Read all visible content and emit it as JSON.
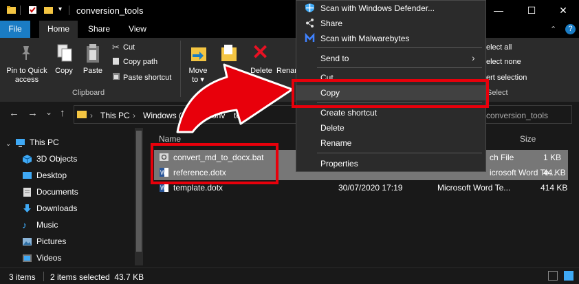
{
  "window": {
    "title": "conversion_tools",
    "controls": {
      "minimize": "—",
      "maximize": "☐",
      "close": "✕"
    }
  },
  "ribbon_tabs": {
    "file": "File",
    "home": "Home",
    "share": "Share",
    "view": "View"
  },
  "ribbon": {
    "pin_to_quick_access_1": "Pin to Quick",
    "pin_to_quick_access_2": "access",
    "copy": "Copy",
    "paste": "Paste",
    "cut": "Cut",
    "copy_path": "Copy path",
    "paste_shortcut": "Paste shortcut",
    "clipboard_group": "Clipboard",
    "move_to_1": "Move",
    "move_to_2": "to ▾",
    "delete": "Delete",
    "rename": "Renam",
    "select_all": "elect all",
    "select_none": "elect none",
    "invert_selection": "ert selection",
    "select_group": "Select"
  },
  "address": {
    "crumb_this_pc": "This PC",
    "crumb_windows": "Windows (C",
    "crumb_folder": "conv",
    "crumb_tools": "tools",
    "search_text": "conversion_tools",
    "nav_back": "←",
    "nav_forward": "→",
    "nav_dropdown": "⌄",
    "nav_up": "↑",
    "sep": "›"
  },
  "nav_pane": {
    "items": [
      {
        "label": "This PC",
        "icon": "computer-icon"
      },
      {
        "label": "3D Objects",
        "icon": "cube-icon"
      },
      {
        "label": "Desktop",
        "icon": "desktop-icon"
      },
      {
        "label": "Documents",
        "icon": "documents-icon"
      },
      {
        "label": "Downloads",
        "icon": "download-icon"
      },
      {
        "label": "Music",
        "icon": "music-icon"
      },
      {
        "label": "Pictures",
        "icon": "pictures-icon"
      },
      {
        "label": "Videos",
        "icon": "videos-icon"
      }
    ]
  },
  "file_list": {
    "columns": {
      "name": "Name",
      "size": "Size"
    },
    "rows": [
      {
        "name": "convert_md_to_docx.bat",
        "date": "",
        "type": "ch File",
        "size": "1 KB",
        "selected": true
      },
      {
        "name": "reference.dotx",
        "date": "",
        "type": "icrosoft Word Te...",
        "size": "44 KB",
        "selected": true
      },
      {
        "name": "template.dotx",
        "date": "30/07/2020 17:19",
        "type": "Microsoft Word Te...",
        "size": "414 KB",
        "selected": false
      }
    ]
  },
  "status": {
    "items_count": "3 items",
    "selection": "2 items selected  43.7 KB"
  },
  "context_menu": {
    "scan_defender": "Scan with Windows Defender...",
    "share": "Share",
    "scan_malwarebytes": "Scan with Malwarebytes",
    "send_to": "Send to",
    "send_to_arrow": "›",
    "cut": "Cut",
    "copy": "Copy",
    "create_shortcut": "Create shortcut",
    "delete": "Delete",
    "rename": "Rename",
    "properties": "Properties"
  },
  "colors": {
    "accent": "#1a7cc4",
    "annotation_red": "#e8000b",
    "selected_row": "#777777"
  }
}
